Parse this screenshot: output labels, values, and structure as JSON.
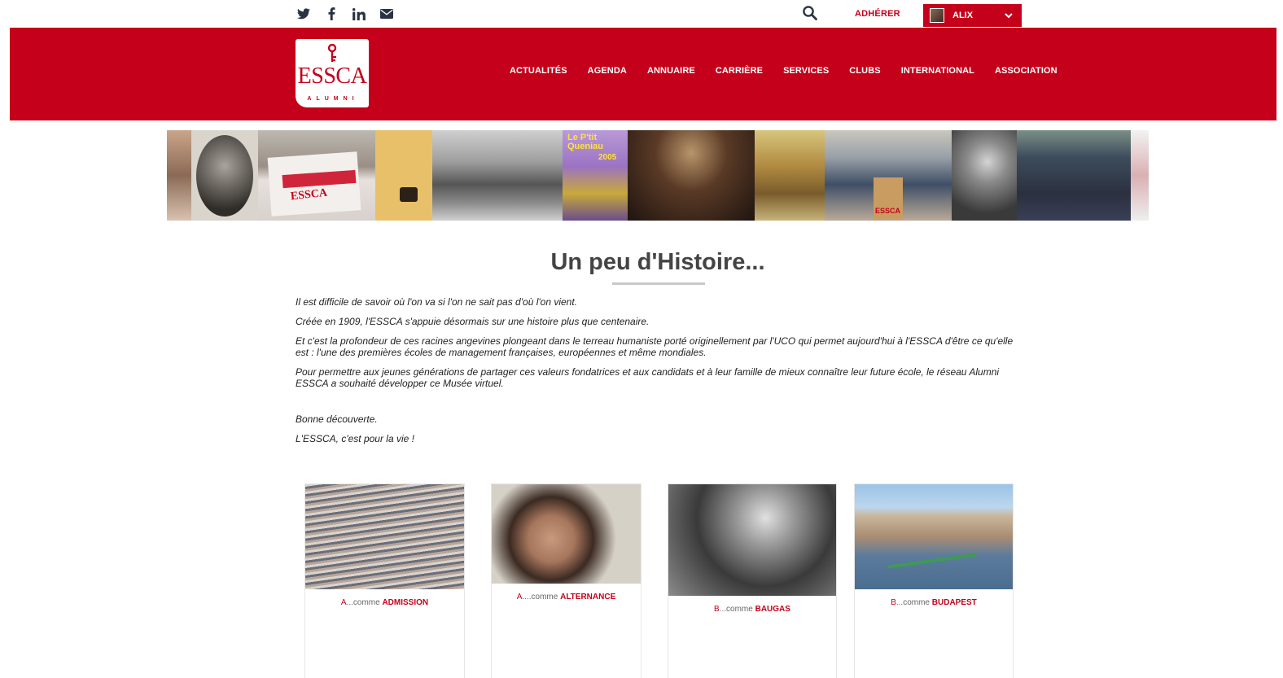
{
  "topbar": {
    "social": [
      "twitter-icon",
      "facebook-icon",
      "linkedin-icon",
      "mail-icon"
    ],
    "search_icon": "search-icon",
    "adherer_label": "ADHÉRER",
    "user_label": "ALIX"
  },
  "header": {
    "logo_brand": "ESSCA",
    "logo_sub": "ALUMNI",
    "nav": [
      "ACTUALITÉS",
      "AGENDA",
      "ANNUAIRE",
      "CARRIÈRE",
      "SERVICES",
      "CLUBS",
      "INTERNATIONAL",
      "ASSOCIATION"
    ]
  },
  "banner": {
    "text_queniau": "Le P'tit Queniau",
    "text_queniau_year": "2005",
    "text_essca_flag": "ESSCA",
    "text_essca_podium": "ESSCA"
  },
  "page": {
    "title": "Un peu d'Histoire...",
    "paragraphs": [
      "Il est difficile de savoir où l'on va si l'on ne sait pas d'où l'on vient.",
      "Créée en 1909, l'ESSCA s'appuie désormais sur une histoire plus que centenaire.",
      "Et c'est la profondeur de ces racines angevines plongeant dans le terreau humaniste porté originellement par l'UCO qui permet aujourd'hui à l'ESSCA d'être ce qu'elle est : l'une des premières écoles de management françaises, européennes et même mondiales.",
      "Pour permettre aux jeunes générations de partager ces valeurs fondatrices et aux candidats et à leur famille de mieux connaître leur future école, le réseau Alumni ESSCA a souhaité développer ce Musée virtuel.",
      "Bonne découverte.",
      "L'ESSCA, c'est pour la vie !"
    ]
  },
  "cards": [
    {
      "letter": "A",
      "connector": "...comme ",
      "word": "ADMISSION"
    },
    {
      "letter": "A",
      "connector": "....comme ",
      "word": "ALTERNANCE"
    },
    {
      "letter": "B",
      "connector": "...comme ",
      "word": "BAUGAS"
    },
    {
      "letter": "B",
      "connector": "...comme ",
      "word": "BUDAPEST"
    }
  ],
  "colors": {
    "brand_red": "#c5001a",
    "heading_gray": "#444444"
  }
}
